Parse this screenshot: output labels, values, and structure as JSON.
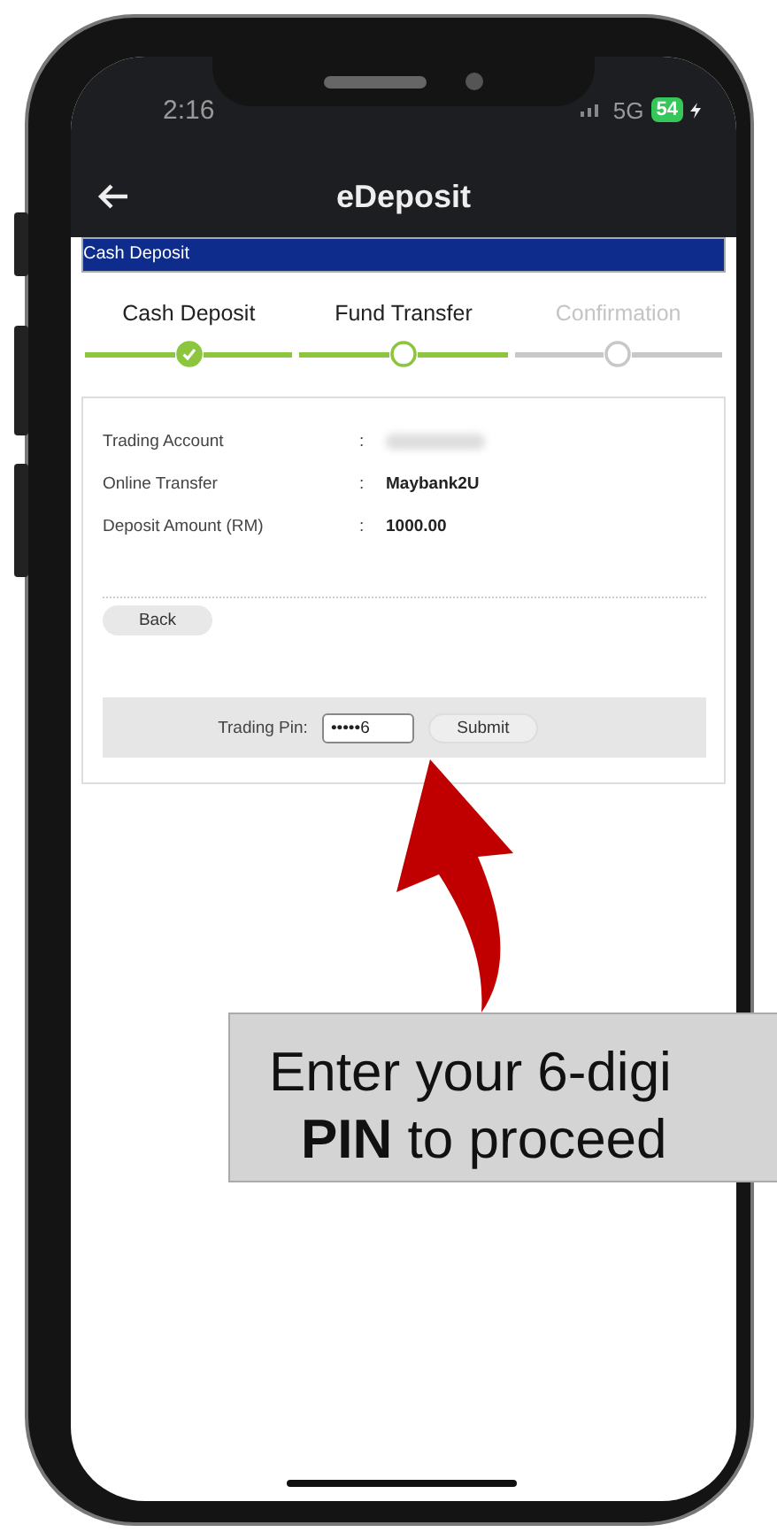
{
  "status_bar": {
    "time": "2:16",
    "network": "5G",
    "battery": "54"
  },
  "header": {
    "title": "eDeposit"
  },
  "section_bar": {
    "title": "Cash Deposit"
  },
  "steps": [
    {
      "label": "Cash Deposit",
      "kind": "done"
    },
    {
      "label": "Fund Transfer",
      "kind": "current"
    },
    {
      "label": "Confirmation",
      "kind": "pending"
    }
  ],
  "details": [
    {
      "label": "Trading Account",
      "separator": ":",
      "value_hidden": true
    },
    {
      "label": "Online Transfer",
      "separator": ":",
      "value": "Maybank2U"
    },
    {
      "label": "Deposit Amount (RM)",
      "separator": ":",
      "value": "1000.00"
    }
  ],
  "back_button": "Back",
  "pin_row": {
    "label": "Trading Pin:",
    "value": "•••••6",
    "submit": "Submit"
  },
  "callout": {
    "lines": [
      "Enter your 6-digi",
      "**PIN** to proceed"
    ]
  }
}
